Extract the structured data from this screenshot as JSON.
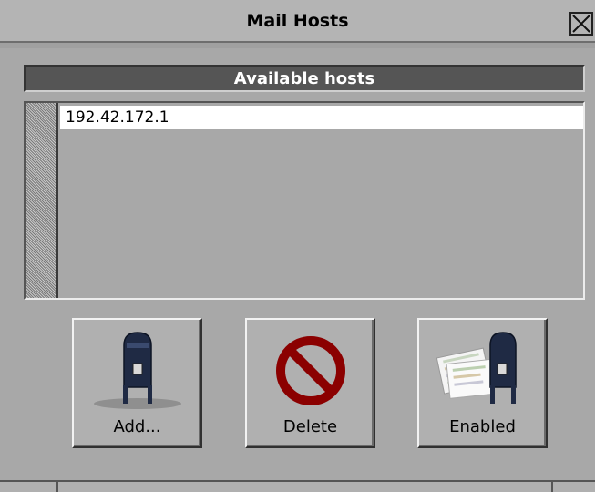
{
  "window": {
    "title": "Mail Hosts"
  },
  "hosts_header": "Available hosts",
  "hosts": [
    {
      "address": "192.42.172.1",
      "selected": true
    }
  ],
  "buttons": {
    "add": {
      "label": "Add...",
      "icon": "mailbox-icon"
    },
    "delete": {
      "label": "Delete",
      "icon": "prohibited-icon"
    },
    "enabled": {
      "label": "Enabled",
      "icon": "mailbox-with-letters-icon"
    }
  },
  "colors": {
    "window_bg": "#a8a8a8",
    "header_bg": "#555555",
    "selected_row": "#ffffff",
    "prohibit_red": "#8b0000"
  }
}
